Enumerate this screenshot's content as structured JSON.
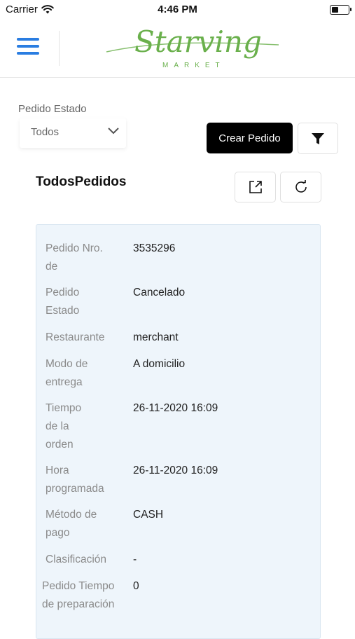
{
  "status_bar": {
    "carrier": "Carrier",
    "time": "4:46 PM"
  },
  "header": {
    "logo_main": "Starving",
    "logo_sub": "MARKET",
    "menu_icon": "hamburger-icon",
    "logo_color": "#6ab04c"
  },
  "filters": {
    "status_label": "Pedido Estado",
    "status_value": "Todos",
    "create_label": "Crear Pedido"
  },
  "section": {
    "title": "TodosPedidos"
  },
  "order": {
    "rows": [
      {
        "key": "Pedido Nro. de",
        "value": "3535296"
      },
      {
        "key": "Pedido Estado",
        "value": "Cancelado"
      },
      {
        "key": "Restaurante",
        "value": "merchant"
      },
      {
        "key": "Modo de entrega",
        "value": "A domicilio"
      },
      {
        "key": "Tiempo de la orden",
        "value": "26-11-2020 16:09"
      },
      {
        "key": "Hora programada",
        "value": "26-11-2020 16:09"
      },
      {
        "key": "Método de pago",
        "value": "CASH"
      },
      {
        "key": "Clasificación",
        "value": "-"
      },
      {
        "key": "Pedido Tiempo de preparación",
        "value": "0"
      }
    ]
  },
  "colors": {
    "accent": "#2a7de1",
    "card_bg": "#eef5fb",
    "button_dark": "#000000"
  }
}
